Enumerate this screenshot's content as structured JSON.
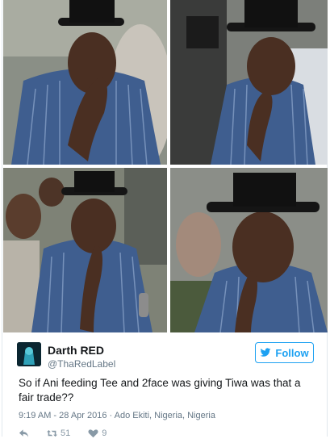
{
  "tweet": {
    "display_name": "Darth RED",
    "handle": "@ThaRedLabel",
    "follow_label": "Follow",
    "text": "So if Ani feeding Tee and 2face was giving Tiwa was that a fair trade??",
    "timestamp": "9:19 AM - 28 Apr 2016 · Ado Ekiti, Nigeria, Nigeria",
    "retweet_count": "51",
    "like_count": "9"
  },
  "colors": {
    "accent": "#1da1f2",
    "muted": "#657786",
    "shirt": "#3a5a8c"
  },
  "icons": [
    "reply-icon",
    "retweet-icon",
    "like-icon",
    "twitter-bird-icon"
  ]
}
